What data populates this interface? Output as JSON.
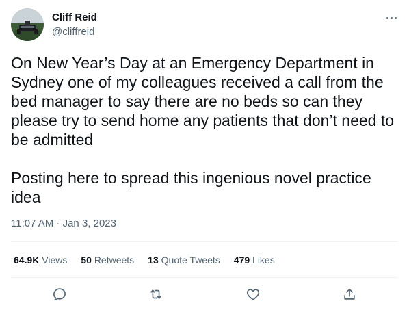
{
  "author": {
    "name": "Cliff Reid",
    "handle": "@cliffreid"
  },
  "tweet": {
    "text": "On New Year’s Day at an Emergency Department in Sydney one of my colleagues received a call from the bed manager to say there are no beds so can they please try to send home any patients that don’t need to be admitted\n\nPosting here to spread this ingenious novel practice idea",
    "timestamp": "11:07 AM · Jan 3, 2023"
  },
  "stats": {
    "views": {
      "count": "64.9K",
      "label": "Views"
    },
    "retweets": {
      "count": "50",
      "label": "Retweets"
    },
    "quote_tweets": {
      "count": "13",
      "label": "Quote Tweets"
    },
    "likes": {
      "count": "479",
      "label": "Likes"
    }
  },
  "icons": {
    "more": "more-horizontal-icon",
    "reply": "reply-icon",
    "retweet": "retweet-icon",
    "like": "heart-icon",
    "share": "share-icon"
  },
  "colors": {
    "text": "#0f1419",
    "secondary": "#536471",
    "divider": "#eff3f4"
  }
}
